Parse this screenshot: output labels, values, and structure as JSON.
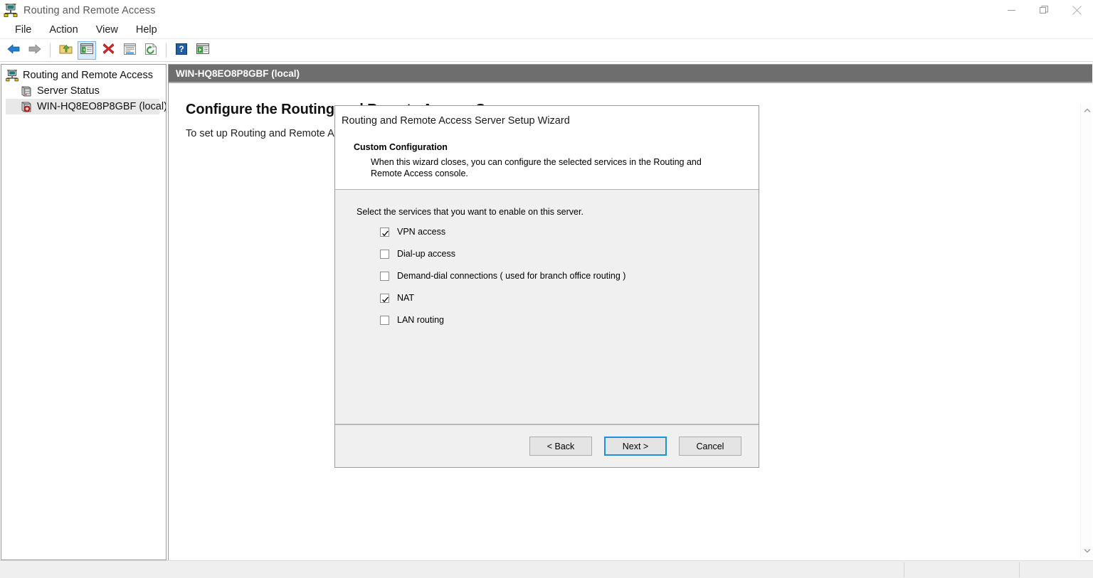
{
  "window": {
    "title": "Routing and Remote Access",
    "icon": "router-network-icon",
    "controls": {
      "minimize": "minimize-icon",
      "restore": "restore-icon",
      "close": "close-icon"
    }
  },
  "menubar": {
    "items": [
      {
        "label": "File"
      },
      {
        "label": "Action"
      },
      {
        "label": "View"
      },
      {
        "label": "Help"
      }
    ]
  },
  "toolbar": {
    "buttons": [
      {
        "name": "back-button",
        "icon": "left-arrow-icon"
      },
      {
        "name": "forward-button",
        "icon": "right-arrow-icon"
      },
      {
        "name": "up-one-level-button",
        "icon": "folder-up-icon"
      },
      {
        "name": "show-hide-console-tree-button",
        "icon": "console-tree-icon",
        "selected": true
      },
      {
        "name": "delete-button",
        "icon": "red-x-icon"
      },
      {
        "name": "properties-button",
        "icon": "properties-window-icon"
      },
      {
        "name": "refresh-button",
        "icon": "refresh-icon"
      },
      {
        "name": "help-button",
        "icon": "question-mark-icon"
      },
      {
        "name": "show-hide-action-pane-button",
        "icon": "action-pane-icon"
      }
    ]
  },
  "tree": {
    "items": [
      {
        "label": "Routing and Remote Access",
        "icon": "router-network-icon",
        "level": 0,
        "selected": false
      },
      {
        "label": "Server Status",
        "icon": "server-stack-icon",
        "level": 1,
        "selected": false
      },
      {
        "label": "WIN-HQ8EO8P8GBF (local)",
        "icon": "server-configure-icon",
        "level": 1,
        "selected": true
      }
    ]
  },
  "content": {
    "header": "WIN-HQ8EO8P8GBF (local)",
    "heading": "Configure the Routing and Remote Access Server",
    "paragraph": "To set up Routing and Remote Access, on the Action menu, click Configure and Enable Routing and Remote Access.",
    "scrollbar": {
      "up_icon": "chevron-up-icon",
      "down_icon": "chevron-down-icon"
    }
  },
  "dialog": {
    "title": "Routing and Remote Access Server Setup Wizard",
    "page_title": "Custom Configuration",
    "page_description": "When this wizard closes, you can configure the selected services in the Routing and Remote Access console.",
    "instruction": "Select the services that you want to enable on this server.",
    "options": [
      {
        "label": "VPN access",
        "checked": true
      },
      {
        "label": "Dial-up access",
        "checked": false
      },
      {
        "label": "Demand-dial connections ( used for branch office routing )",
        "checked": false
      },
      {
        "label": "NAT",
        "checked": true
      },
      {
        "label": "LAN routing",
        "checked": false
      }
    ],
    "buttons": {
      "back": "< Back",
      "next": "Next >",
      "cancel": "Cancel"
    },
    "accent_color": "#1e90dd"
  },
  "statusbar": {
    "segments": [
      "",
      "",
      ""
    ]
  }
}
